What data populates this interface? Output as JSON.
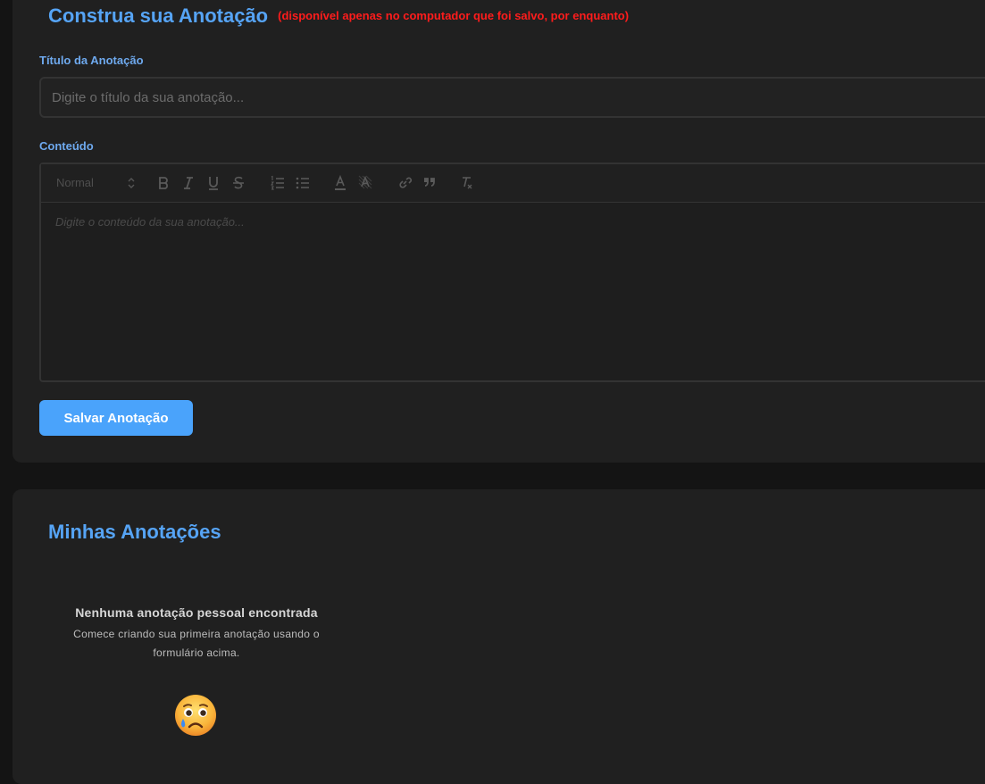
{
  "form": {
    "title": "Construa sua Anotação",
    "note": "(disponível apenas no computador que foi salvo, por enquanto)",
    "title_label": "Título da Anotação",
    "title_placeholder": "Digite o título da sua anotação...",
    "content_label": "Conteúdo",
    "editor": {
      "format_select": "Normal",
      "toolbar_icons": [
        "bold-icon",
        "italic-icon",
        "underline-icon",
        "strikethrough-icon",
        "ordered-list-icon",
        "bullet-list-icon",
        "text-color-icon",
        "background-color-icon",
        "link-icon",
        "blockquote-icon",
        "clear-format-icon"
      ],
      "placeholder": "Digite o conteúdo da sua anotação..."
    },
    "save_label": "Salvar Anotação"
  },
  "notes_list": {
    "title": "Minhas Anotações",
    "empty_title": "Nenhuma anotação pessoal encontrada",
    "empty_text": "Comece criando sua primeira anotação usando o formulário acima.",
    "empty_icon": "crying-face-emoji"
  },
  "colors": {
    "accent": "#56a4f5",
    "button": "#4aa3fb",
    "warning": "#ff1c1c",
    "panel": "#202020",
    "background": "#141414"
  }
}
